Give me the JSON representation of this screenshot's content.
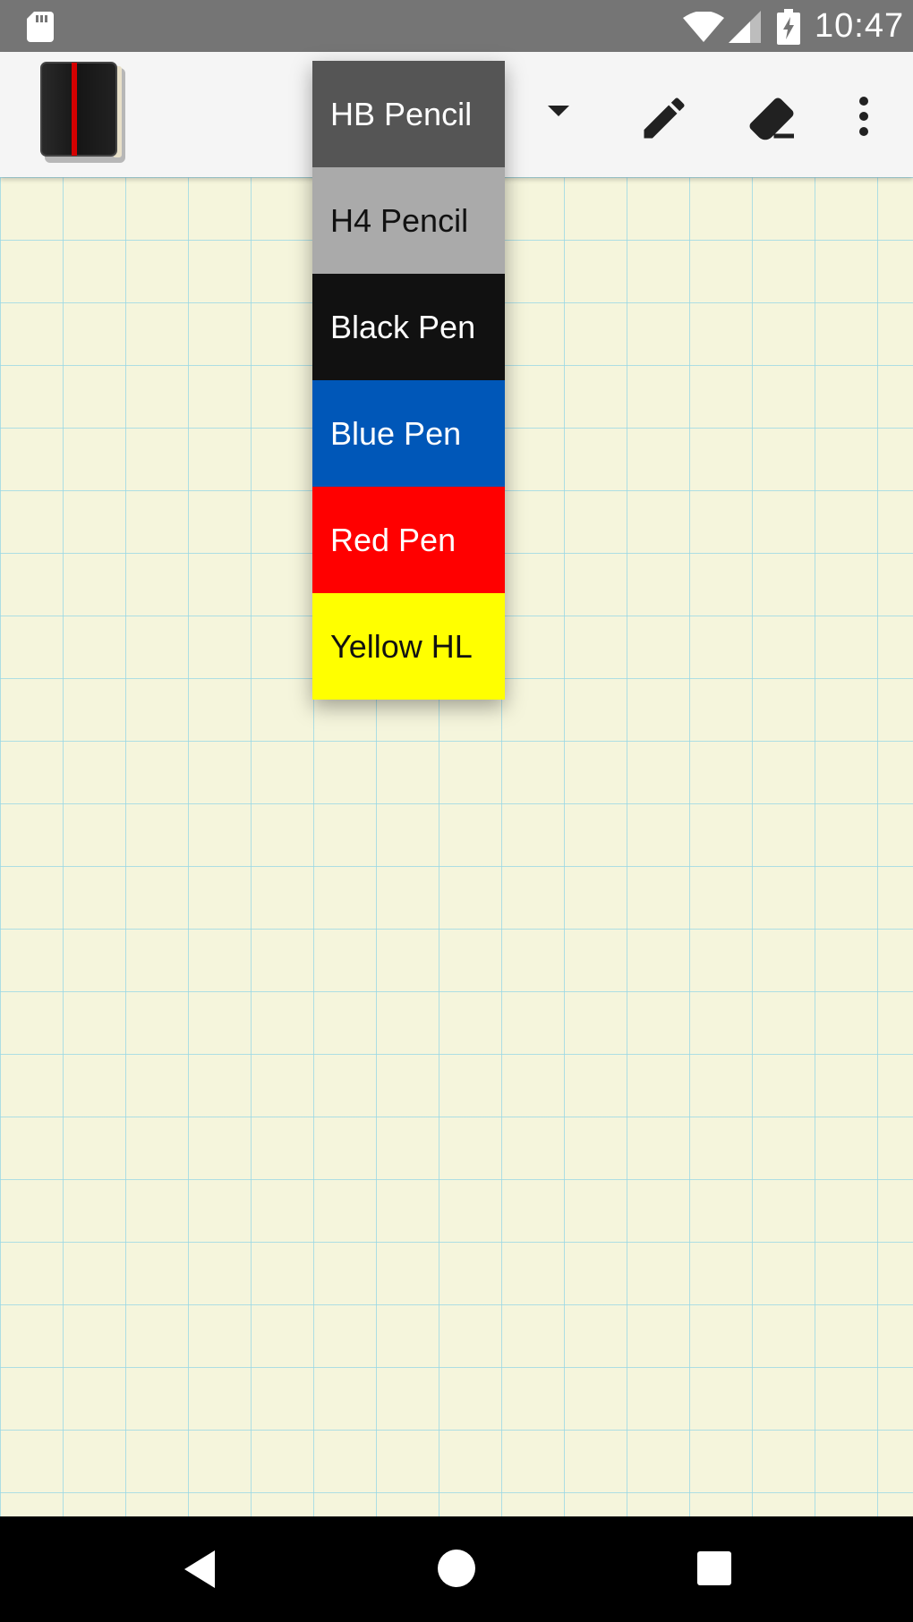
{
  "status_bar": {
    "time": "10:47",
    "icons": [
      "sd-card-icon",
      "wifi-icon",
      "cell-signal-icon",
      "battery-charging-icon"
    ]
  },
  "app_bar": {
    "logo": "notebook-logo-icon",
    "actions": [
      "dropdown-arrow-icon",
      "pencil-icon",
      "eraser-icon",
      "more-vert-icon"
    ]
  },
  "pen_menu": {
    "items": [
      {
        "label": "HB Pencil",
        "bg": "#555555",
        "fg": "#ffffff"
      },
      {
        "label": "H4 Pencil",
        "bg": "#aaaaaa",
        "fg": "#111111"
      },
      {
        "label": "Black Pen",
        "bg": "#111111",
        "fg": "#ffffff"
      },
      {
        "label": "Blue Pen",
        "bg": "#0057b8",
        "fg": "#ffffff"
      },
      {
        "label": "Red Pen",
        "bg": "#ff0000",
        "fg": "#ffffff"
      },
      {
        "label": "Yellow HL",
        "bg": "#ffff00",
        "fg": "#111111"
      }
    ]
  },
  "canvas": {
    "paper_color": "#f5f5dc",
    "grid_color": "#96d7e6"
  },
  "nav_bar": {
    "buttons": [
      "back-icon",
      "home-icon",
      "recents-icon"
    ]
  }
}
